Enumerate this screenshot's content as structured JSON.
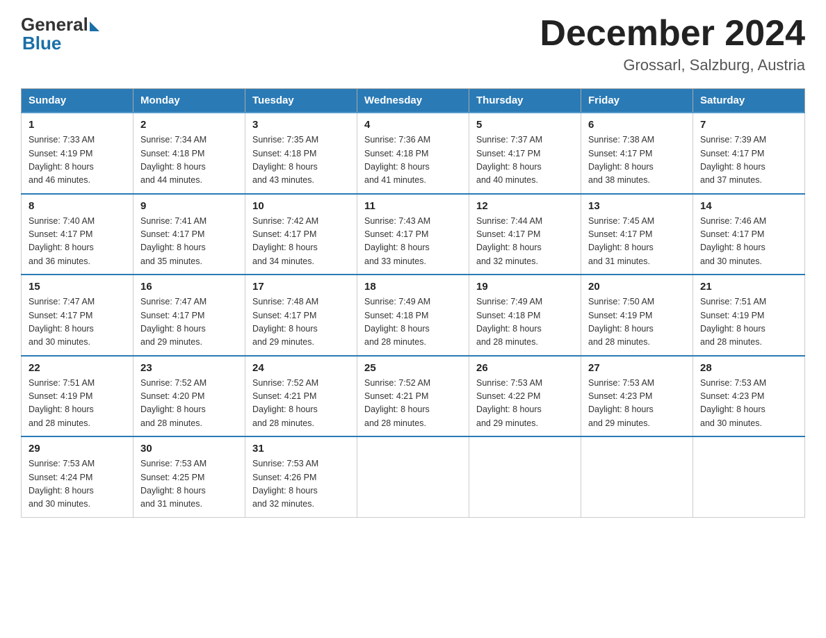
{
  "header": {
    "logo_general": "General",
    "logo_blue": "Blue",
    "month_title": "December 2024",
    "location": "Grossarl, Salzburg, Austria"
  },
  "days_of_week": [
    "Sunday",
    "Monday",
    "Tuesday",
    "Wednesday",
    "Thursday",
    "Friday",
    "Saturday"
  ],
  "weeks": [
    [
      {
        "day": "1",
        "sunrise": "7:33 AM",
        "sunset": "4:19 PM",
        "daylight": "8 hours and 46 minutes."
      },
      {
        "day": "2",
        "sunrise": "7:34 AM",
        "sunset": "4:18 PM",
        "daylight": "8 hours and 44 minutes."
      },
      {
        "day": "3",
        "sunrise": "7:35 AM",
        "sunset": "4:18 PM",
        "daylight": "8 hours and 43 minutes."
      },
      {
        "day": "4",
        "sunrise": "7:36 AM",
        "sunset": "4:18 PM",
        "daylight": "8 hours and 41 minutes."
      },
      {
        "day": "5",
        "sunrise": "7:37 AM",
        "sunset": "4:17 PM",
        "daylight": "8 hours and 40 minutes."
      },
      {
        "day": "6",
        "sunrise": "7:38 AM",
        "sunset": "4:17 PM",
        "daylight": "8 hours and 38 minutes."
      },
      {
        "day": "7",
        "sunrise": "7:39 AM",
        "sunset": "4:17 PM",
        "daylight": "8 hours and 37 minutes."
      }
    ],
    [
      {
        "day": "8",
        "sunrise": "7:40 AM",
        "sunset": "4:17 PM",
        "daylight": "8 hours and 36 minutes."
      },
      {
        "day": "9",
        "sunrise": "7:41 AM",
        "sunset": "4:17 PM",
        "daylight": "8 hours and 35 minutes."
      },
      {
        "day": "10",
        "sunrise": "7:42 AM",
        "sunset": "4:17 PM",
        "daylight": "8 hours and 34 minutes."
      },
      {
        "day": "11",
        "sunrise": "7:43 AM",
        "sunset": "4:17 PM",
        "daylight": "8 hours and 33 minutes."
      },
      {
        "day": "12",
        "sunrise": "7:44 AM",
        "sunset": "4:17 PM",
        "daylight": "8 hours and 32 minutes."
      },
      {
        "day": "13",
        "sunrise": "7:45 AM",
        "sunset": "4:17 PM",
        "daylight": "8 hours and 31 minutes."
      },
      {
        "day": "14",
        "sunrise": "7:46 AM",
        "sunset": "4:17 PM",
        "daylight": "8 hours and 30 minutes."
      }
    ],
    [
      {
        "day": "15",
        "sunrise": "7:47 AM",
        "sunset": "4:17 PM",
        "daylight": "8 hours and 30 minutes."
      },
      {
        "day": "16",
        "sunrise": "7:47 AM",
        "sunset": "4:17 PM",
        "daylight": "8 hours and 29 minutes."
      },
      {
        "day": "17",
        "sunrise": "7:48 AM",
        "sunset": "4:17 PM",
        "daylight": "8 hours and 29 minutes."
      },
      {
        "day": "18",
        "sunrise": "7:49 AM",
        "sunset": "4:18 PM",
        "daylight": "8 hours and 28 minutes."
      },
      {
        "day": "19",
        "sunrise": "7:49 AM",
        "sunset": "4:18 PM",
        "daylight": "8 hours and 28 minutes."
      },
      {
        "day": "20",
        "sunrise": "7:50 AM",
        "sunset": "4:19 PM",
        "daylight": "8 hours and 28 minutes."
      },
      {
        "day": "21",
        "sunrise": "7:51 AM",
        "sunset": "4:19 PM",
        "daylight": "8 hours and 28 minutes."
      }
    ],
    [
      {
        "day": "22",
        "sunrise": "7:51 AM",
        "sunset": "4:19 PM",
        "daylight": "8 hours and 28 minutes."
      },
      {
        "day": "23",
        "sunrise": "7:52 AM",
        "sunset": "4:20 PM",
        "daylight": "8 hours and 28 minutes."
      },
      {
        "day": "24",
        "sunrise": "7:52 AM",
        "sunset": "4:21 PM",
        "daylight": "8 hours and 28 minutes."
      },
      {
        "day": "25",
        "sunrise": "7:52 AM",
        "sunset": "4:21 PM",
        "daylight": "8 hours and 28 minutes."
      },
      {
        "day": "26",
        "sunrise": "7:53 AM",
        "sunset": "4:22 PM",
        "daylight": "8 hours and 29 minutes."
      },
      {
        "day": "27",
        "sunrise": "7:53 AM",
        "sunset": "4:23 PM",
        "daylight": "8 hours and 29 minutes."
      },
      {
        "day": "28",
        "sunrise": "7:53 AM",
        "sunset": "4:23 PM",
        "daylight": "8 hours and 30 minutes."
      }
    ],
    [
      {
        "day": "29",
        "sunrise": "7:53 AM",
        "sunset": "4:24 PM",
        "daylight": "8 hours and 30 minutes."
      },
      {
        "day": "30",
        "sunrise": "7:53 AM",
        "sunset": "4:25 PM",
        "daylight": "8 hours and 31 minutes."
      },
      {
        "day": "31",
        "sunrise": "7:53 AM",
        "sunset": "4:26 PM",
        "daylight": "8 hours and 32 minutes."
      },
      null,
      null,
      null,
      null
    ]
  ],
  "labels": {
    "sunrise": "Sunrise:",
    "sunset": "Sunset:",
    "daylight": "Daylight:"
  }
}
